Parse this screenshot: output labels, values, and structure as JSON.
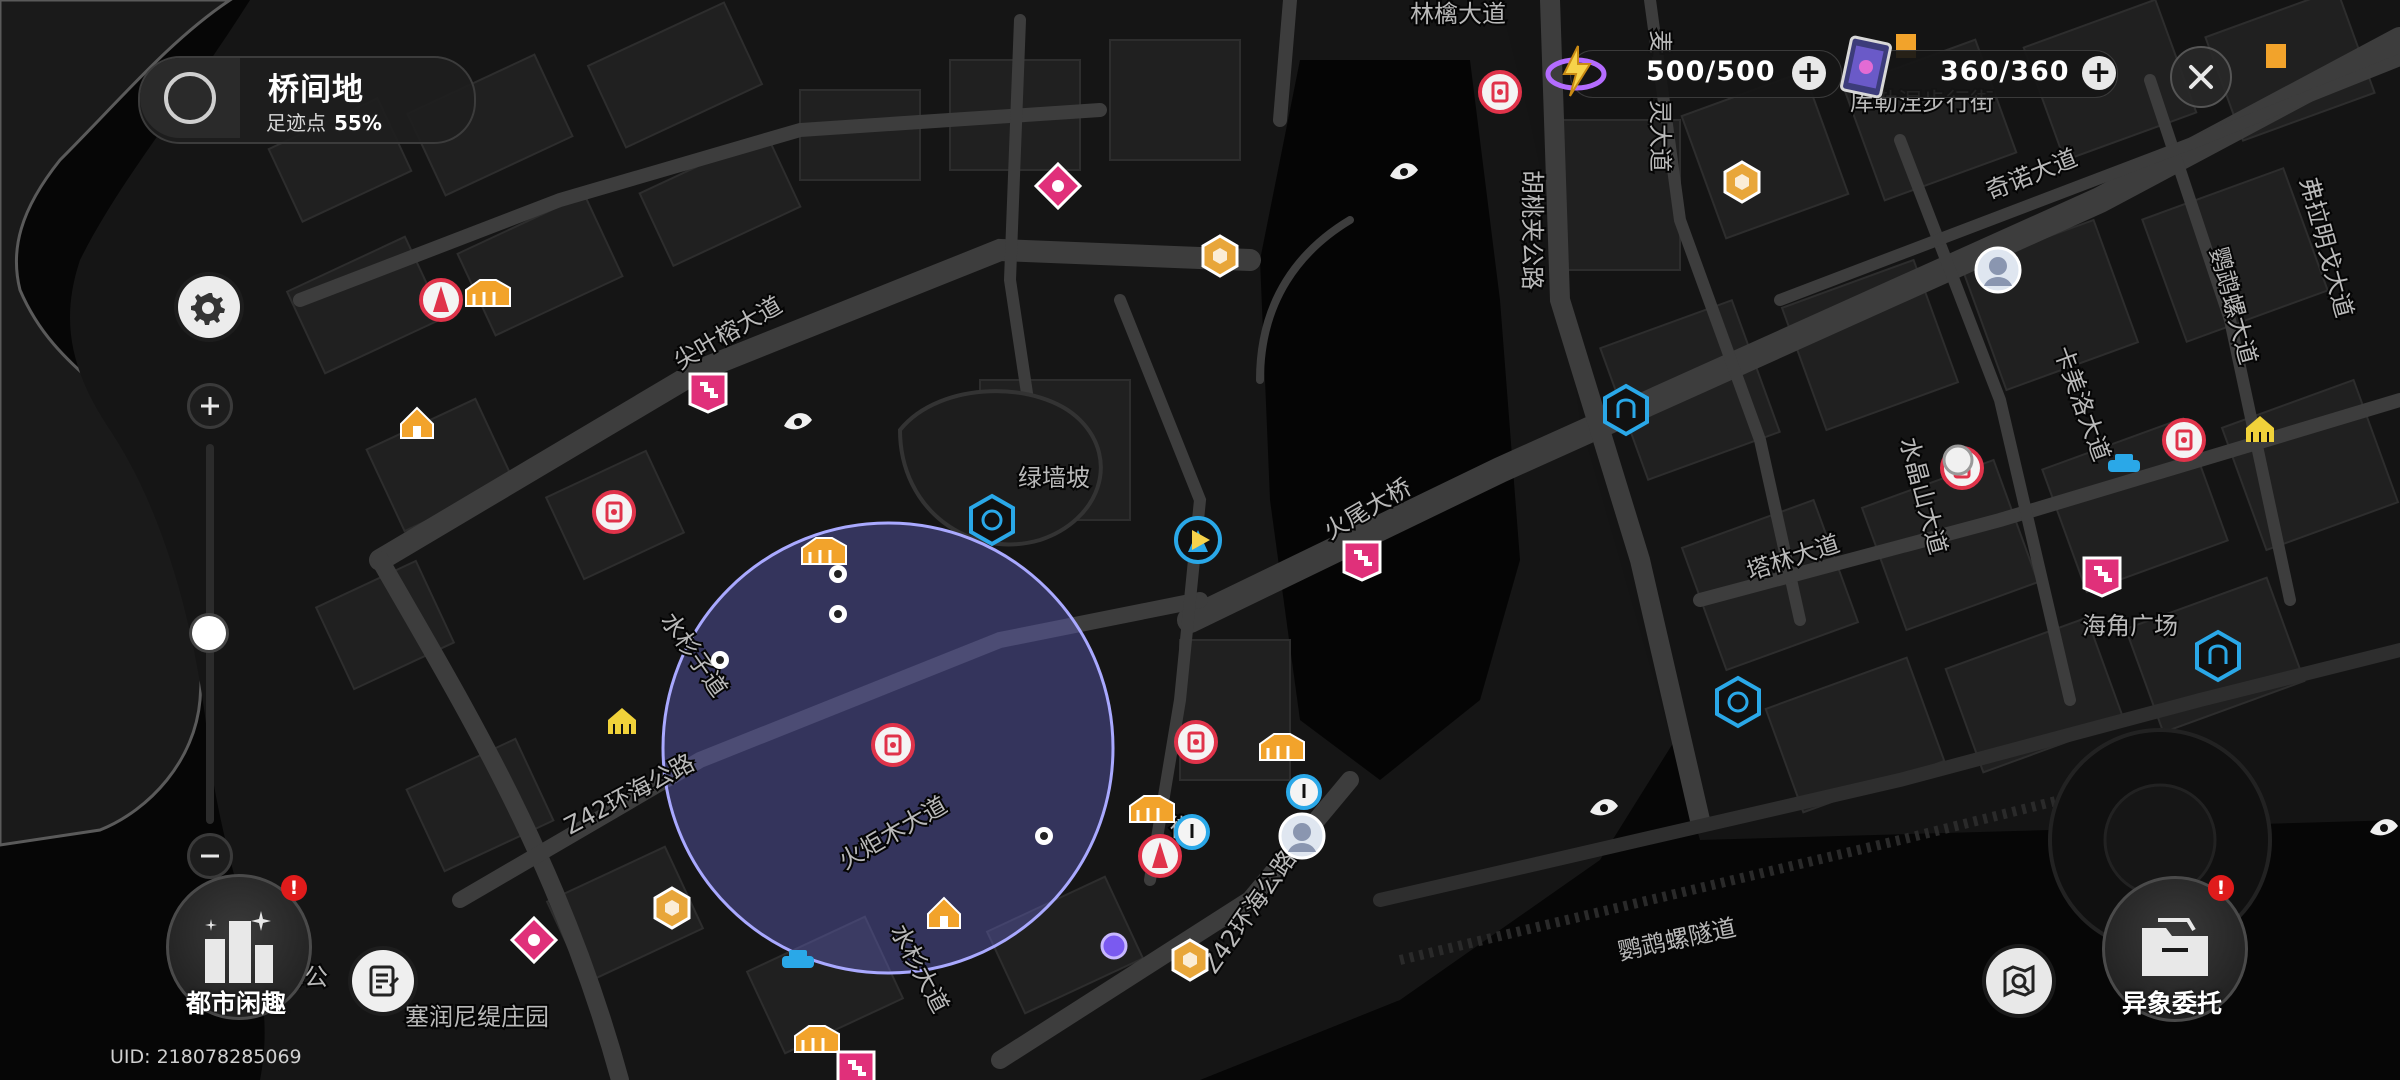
{
  "region": {
    "name": "桥间地",
    "footprint_label": "足迹点",
    "footprint_value": "55%",
    "icon": "compass-icon"
  },
  "resources": [
    {
      "value": "500/500",
      "icon": "battery-charge-icon",
      "plus_icon": "plus-icon"
    },
    {
      "value": "360/360",
      "icon": "card-pack-icon",
      "plus_icon": "plus-icon"
    }
  ],
  "controls": {
    "close_icon": "close-icon",
    "settings_icon": "gear-icon",
    "zoom_in_icon": "plus-icon",
    "zoom_out_icon": "minus-icon",
    "city_button_label": "都市闲趣",
    "city_button_icon": "city-buildings-icon",
    "notes_icon": "notes-icon",
    "search_icon": "map-search-icon",
    "commission_label": "异象委托",
    "commission_icon": "folder-icon",
    "alert_mark": "!"
  },
  "uid": "UID: 218078285069",
  "map_labels": [
    {
      "text": "林檎大道"
    },
    {
      "text": "库勒涅步行街"
    },
    {
      "text": "奇诺大道"
    },
    {
      "text": "弗拉明戈大道"
    },
    {
      "text": "鹦鹉螺大道"
    },
    {
      "text": "麦"
    },
    {
      "text": "灵大道"
    },
    {
      "text": "胡桃夹公路"
    },
    {
      "text": "卡美洛大道"
    },
    {
      "text": "水晶山大道"
    },
    {
      "text": "塔林大道"
    },
    {
      "text": "海角广场"
    },
    {
      "text": "绿墙坡"
    },
    {
      "text": "火尾大桥"
    },
    {
      "text": "尖叶榕大道"
    },
    {
      "text": "水杉子道"
    },
    {
      "text": "Z42环海公路"
    },
    {
      "text": "火炬木大道"
    },
    {
      "text": "水杉大道"
    },
    {
      "text": "Z42环海公路"
    },
    {
      "text": "鹦鹉螺隧道"
    },
    {
      "text": "塞润尼缇庄园"
    },
    {
      "text": "海公"
    },
    {
      "text": "街"
    }
  ],
  "markers": [
    "shop-marker-icon",
    "tower-marker-icon",
    "home-marker-icon",
    "race-flag-icon",
    "gold-hex-icon",
    "ticket-marker-icon",
    "arch-gate-icon",
    "car-marker-icon",
    "temple-marker-icon",
    "mission-marker-icon",
    "player-location-icon",
    "character-portrait-icon",
    "fork-knife-marker-icon",
    "anomaly-marker-icon"
  ],
  "colors": {
    "background": "#050505",
    "road": "#3a3a3a",
    "block": "#1c1c1c",
    "marker_red": "#e0334a",
    "marker_orange": "#f2a32b",
    "marker_pink": "#e0307a",
    "marker_blue": "#2aa8e8",
    "player_range": "#6a6ab8"
  }
}
